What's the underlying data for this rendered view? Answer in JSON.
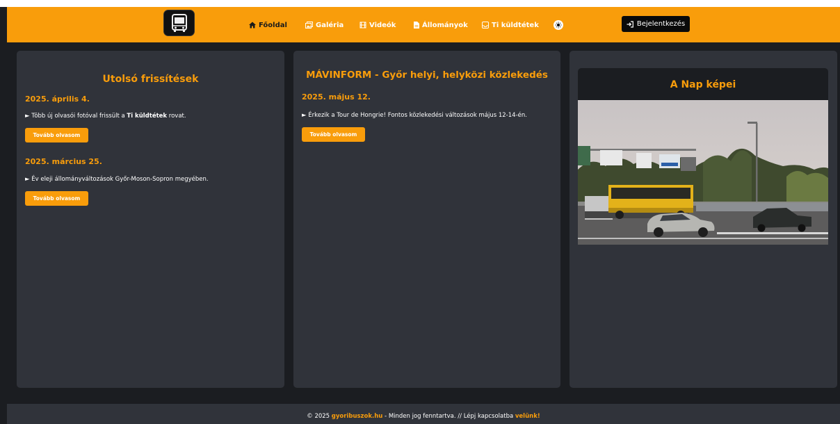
{
  "nav": {
    "items": [
      {
        "label": "Főoldal",
        "icon": "home-icon"
      },
      {
        "label": "Galéria",
        "icon": "images-icon"
      },
      {
        "label": "Videók",
        "icon": "film-icon"
      },
      {
        "label": "Állományok",
        "icon": "file-icon"
      },
      {
        "label": "Ti küldtétek",
        "icon": "inbox-icon"
      }
    ],
    "login_label": "Bejelentkezés",
    "theme_icon": "sun-icon",
    "logo_icon": "bus-icon"
  },
  "updates": {
    "title": "Utolsó frissítések",
    "entries": [
      {
        "date": "2025. április 4.",
        "text_before": "► Több új olvasói fotóval frissült a ",
        "text_bold": "Ti küldtétek",
        "text_after": " rovat.",
        "button": "Tovább olvasom"
      },
      {
        "date": "2025. március 25.",
        "text": "► Év eleji állományváltozások Győr-Moson-Sopron megyében.",
        "button": "Tovább olvasom"
      }
    ]
  },
  "mavinform": {
    "title": "MÁVINFORM - Győr helyi, helyközi közlekedés",
    "entries": [
      {
        "date": "2025. május 12.",
        "text": "► Érkezik a Tour de Hongrie! Fontos közlekedési változások május 12-14-én.",
        "button": "Tovább olvasom"
      }
    ]
  },
  "photo_of_day": {
    "title": "A Nap képei"
  },
  "footer": {
    "prefix": "© 2025 ",
    "site": "gyoribuszok.hu",
    "middle": " - Minden jog fenntartva. // Lépj kapcsolatba ",
    "link": "velünk!"
  },
  "colors": {
    "accent": "#f99d0b",
    "background": "#1b1d21",
    "card": "#30333a"
  }
}
